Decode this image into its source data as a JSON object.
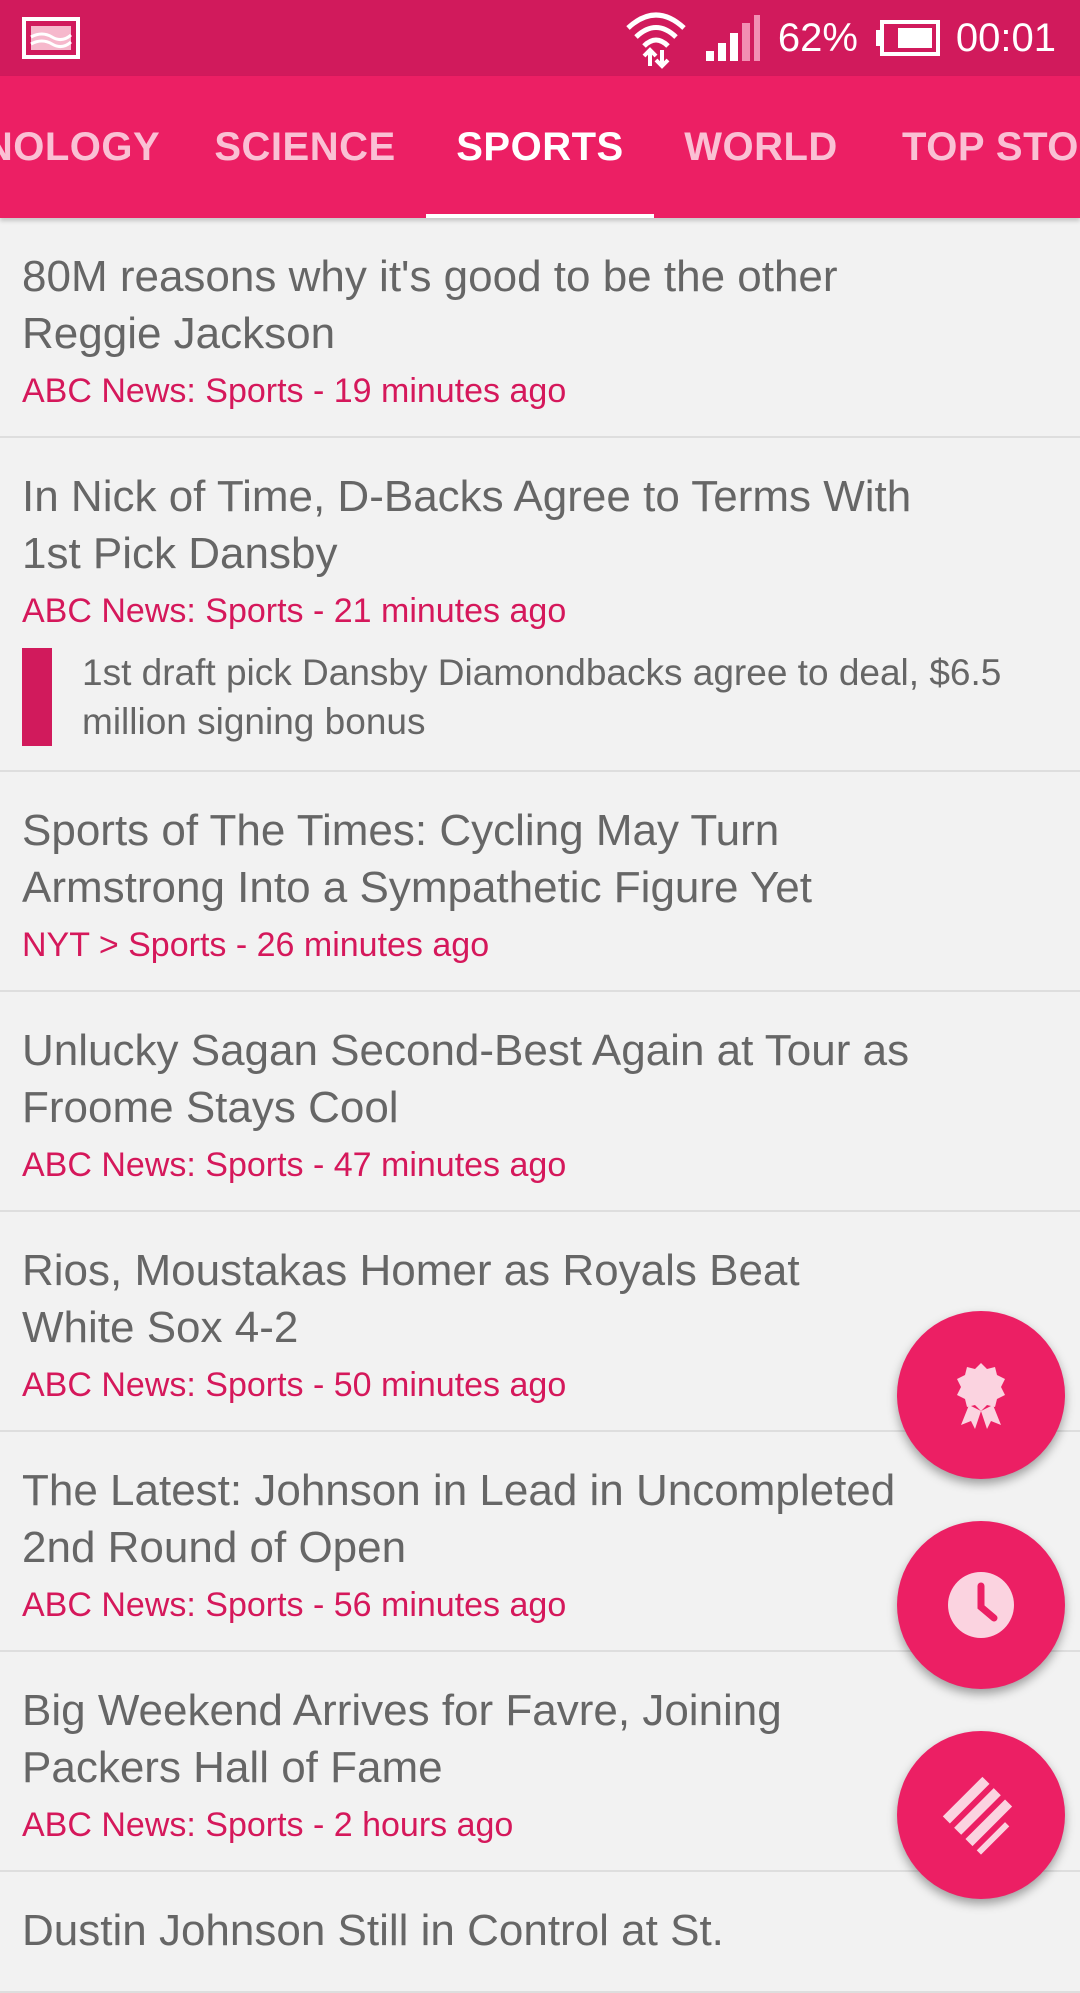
{
  "status_bar": {
    "battery_percent": "62%",
    "time": "00:01",
    "icons": [
      "gallery-notification-icon",
      "wifi-data-icon",
      "cell-signal-icon",
      "battery-icon"
    ]
  },
  "tabs": [
    {
      "label": "NOLOGY"
    },
    {
      "label": "SCIENCE"
    },
    {
      "label": "SPORTS",
      "active": true
    },
    {
      "label": "WORLD"
    },
    {
      "label": "TOP STOR"
    }
  ],
  "articles": [
    {
      "title": "80M reasons why it's good to be the other Reggie Jackson",
      "meta": "ABC News: Sports - 19 minutes ago"
    },
    {
      "title": "In Nick of Time, D-Backs Agree to Terms With 1st Pick Dansby",
      "meta": "ABC News: Sports - 21 minutes ago",
      "sub": "1st draft pick Dansby Diamondbacks agree to deal, $6.5 million signing bonus"
    },
    {
      "title": "Sports of The Times: Cycling May Turn Armstrong Into a Sympathetic Figure Yet",
      "meta": "NYT > Sports - 26 minutes ago"
    },
    {
      "title": "Unlucky Sagan Second-Best Again at Tour as Froome Stays Cool",
      "meta": "ABC News: Sports - 47 minutes ago"
    },
    {
      "title": "Rios, Moustakas Homer as Royals Beat White Sox 4-2",
      "meta": "ABC News: Sports - 50 minutes ago"
    },
    {
      "title": "The Latest: Johnson in Lead in Uncompleted 2nd Round of Open",
      "meta": "ABC News: Sports - 56 minutes ago"
    },
    {
      "title": "Big Weekend Arrives for Favre, Joining Packers Hall of Fame",
      "meta": "ABC News: Sports - 2 hours ago"
    },
    {
      "title": "Dustin Johnson Still in Control at St.",
      "meta": ""
    }
  ],
  "fabs": [
    {
      "icon": "award-ribbon-icon"
    },
    {
      "icon": "clock-icon"
    },
    {
      "icon": "news-stack-icon"
    }
  ],
  "colors": {
    "status_bar": "#d11a5c",
    "tab_bar": "#ec1f64",
    "accent": "#d5185b",
    "background": "#f2f2f2",
    "title_text": "#666666"
  }
}
